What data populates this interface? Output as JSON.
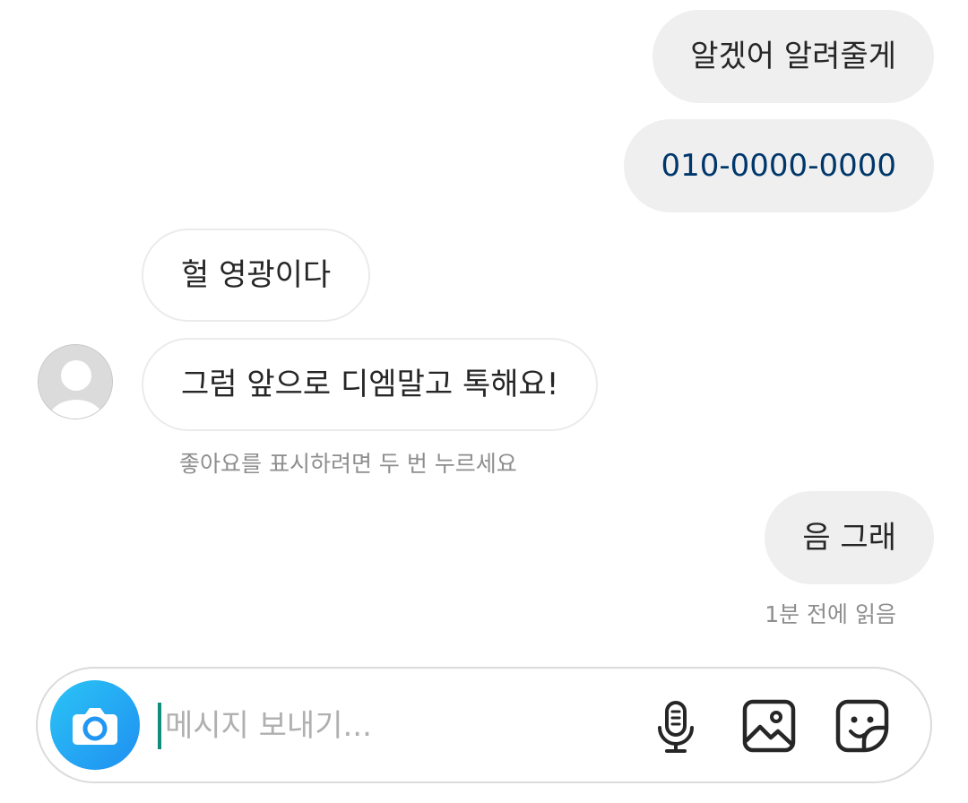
{
  "messages": [
    {
      "text": "알겠어 알려줄게",
      "direction": "outgoing"
    },
    {
      "text": "010-0000-0000",
      "direction": "outgoing",
      "is_link": true
    },
    {
      "text": "헐 영광이다",
      "direction": "incoming"
    },
    {
      "text": "그럼 앞으로 디엠말고 톡해요!",
      "direction": "incoming"
    },
    {
      "text": "음 그래",
      "direction": "outgoing"
    }
  ],
  "hints": {
    "double_tap_like": "좋아요를 표시하려면 두 번 누르세요",
    "seen_status": "1분 전에 읽음"
  },
  "composer": {
    "placeholder": "메시지 보내기...",
    "value": ""
  },
  "icons": {
    "camera": "camera-icon",
    "mic": "microphone-icon",
    "gallery": "image-icon",
    "sticker": "sticker-icon",
    "avatar": "default-avatar"
  },
  "colors": {
    "outgoing_bubble": "#efefef",
    "incoming_border": "#ebebeb",
    "link": "#00376b",
    "camera_button": "#2196f3",
    "caret": "#128c7e",
    "hint_text": "#8e8e8e"
  }
}
